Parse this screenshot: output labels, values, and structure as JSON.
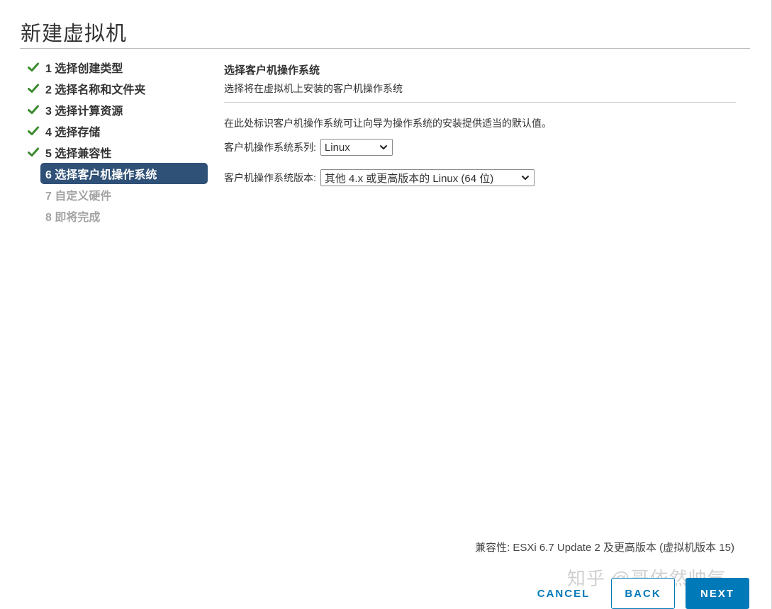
{
  "window": {
    "title": "新建虚拟机"
  },
  "colors": {
    "accent": "#0079b8",
    "current_step_bg": "#2f5177",
    "check": "#3c8b2f",
    "pending_text": "#a3a3a3"
  },
  "steps": [
    {
      "label": "1 选择创建类型",
      "state": "done",
      "icon": "check-icon"
    },
    {
      "label": "2 选择名称和文件夹",
      "state": "done",
      "icon": "check-icon"
    },
    {
      "label": "3 选择计算资源",
      "state": "done",
      "icon": "check-icon"
    },
    {
      "label": "4 选择存储",
      "state": "done",
      "icon": "check-icon"
    },
    {
      "label": "5 选择兼容性",
      "state": "done",
      "icon": "check-icon"
    },
    {
      "label": "6 选择客户机操作系统",
      "state": "current"
    },
    {
      "label": "7 自定义硬件",
      "state": "pending"
    },
    {
      "label": "8 即将完成",
      "state": "pending"
    }
  ],
  "main": {
    "heading": "选择客户机操作系统",
    "subheading": "选择将在虚拟机上安装的客户机操作系统",
    "description": "在此处标识客户机操作系统可让向导为操作系统的安装提供适当的默认值。",
    "os_family": {
      "label": "客户机操作系统系列:",
      "value": "Linux",
      "icon": "chevron-down-icon"
    },
    "os_version": {
      "label": "客户机操作系统版本:",
      "value": "其他 4.x 或更高版本的 Linux (64 位)",
      "icon": "chevron-down-icon"
    }
  },
  "footer": {
    "compatibility": "兼容性: ESXi 6.7 Update 2 及更高版本 (虚拟机版本 15)",
    "cancel_label": "CANCEL",
    "back_label": "BACK",
    "next_label": "NEXT"
  },
  "watermark": "知乎 @哥依然帅气"
}
